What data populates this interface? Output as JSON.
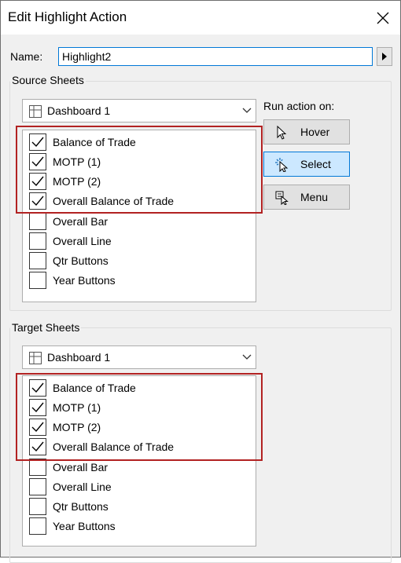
{
  "window": {
    "title": "Edit Highlight Action"
  },
  "name_field": {
    "label": "Name:",
    "value": "Highlight2"
  },
  "source_sheets": {
    "group_label": "Source Sheets",
    "dashboard": "Dashboard 1",
    "sheets": [
      {
        "label": "Balance of Trade",
        "checked": true
      },
      {
        "label": "MOTP (1)",
        "checked": true
      },
      {
        "label": "MOTP (2)",
        "checked": true
      },
      {
        "label": "Overall Balance of Trade",
        "checked": true
      },
      {
        "label": "Overall Bar",
        "checked": false
      },
      {
        "label": "Overall Line",
        "checked": false
      },
      {
        "label": "Qtr Buttons",
        "checked": false
      },
      {
        "label": "Year Buttons",
        "checked": false
      }
    ]
  },
  "run_action": {
    "label": "Run action on:",
    "options": [
      {
        "label": "Hover",
        "icon": "pointer-icon",
        "selected": false
      },
      {
        "label": "Select",
        "icon": "select-click-icon",
        "selected": true
      },
      {
        "label": "Menu",
        "icon": "menu-pointer-icon",
        "selected": false
      }
    ]
  },
  "target_sheets": {
    "group_label": "Target Sheets",
    "dashboard": "Dashboard 1",
    "sheets": [
      {
        "label": "Balance of Trade",
        "checked": true
      },
      {
        "label": "MOTP (1)",
        "checked": true
      },
      {
        "label": "MOTP (2)",
        "checked": true
      },
      {
        "label": "Overall Balance of Trade",
        "checked": true
      },
      {
        "label": "Overall Bar",
        "checked": false
      },
      {
        "label": "Overall Line",
        "checked": false
      },
      {
        "label": "Qtr Buttons",
        "checked": false
      },
      {
        "label": "Year Buttons",
        "checked": false
      }
    ]
  },
  "colors": {
    "highlight_border": "#b22222",
    "selected_button": "#cce8ff",
    "focus_border": "#0078d7"
  }
}
